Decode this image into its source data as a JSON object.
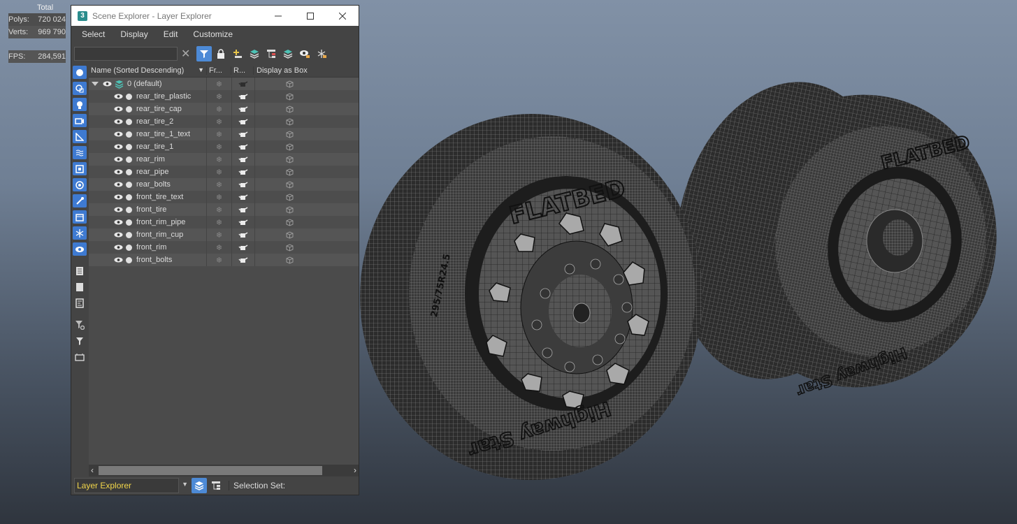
{
  "viewport": {
    "stats": {
      "header": "Total",
      "polys_label": "Polys:",
      "polys_value": "720 024",
      "verts_label": "Verts:",
      "verts_value": "969 790",
      "fps_label": "FPS:",
      "fps_value": "284,591"
    },
    "tire_brand": "FLATBED",
    "tire_model": "Highway Star",
    "tire_size": "295/75R24.5"
  },
  "window": {
    "title": "Scene Explorer - Layer Explorer",
    "app_icon": "3",
    "menu": [
      "Select",
      "Display",
      "Edit",
      "Customize"
    ],
    "columns": {
      "name": "Name (Sorted Descending)",
      "frozen": "Fr...",
      "render": "R...",
      "display_box": "Display as Box"
    },
    "layer": "0 (default)",
    "items": [
      "rear_tire_plastic",
      "rear_tire_cap",
      "rear_tire_2",
      "rear_tire_1_text",
      "rear_tire_1",
      "rear_rim",
      "rear_pipe",
      "rear_bolts",
      "front_tire_text",
      "front_tire",
      "front_rim_pipe",
      "front_rim_cup",
      "front_rim",
      "front_bolts"
    ],
    "explorer_selector": "Layer Explorer",
    "selection_set_label": "Selection Set:"
  },
  "colors": {
    "accent": "#4d8ad6",
    "panel": "#444444",
    "selector_text": "#f2d64a"
  }
}
